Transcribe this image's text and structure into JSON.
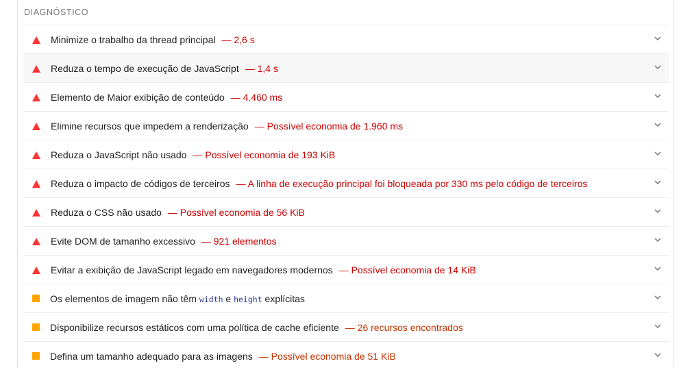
{
  "section": {
    "title": "DIAGNÓSTICO"
  },
  "audits": [
    {
      "status": "fail",
      "title": "Minimize o trabalho da thread principal",
      "display": "— 2,6 s"
    },
    {
      "status": "fail",
      "title": "Reduza o tempo de execução de JavaScript",
      "display": "— 1,4 s"
    },
    {
      "status": "fail",
      "title": "Elemento de Maior exibição de conteúdo",
      "display": "— 4.460 ms"
    },
    {
      "status": "fail",
      "title": "Elimine recursos que impedem a renderização",
      "display": "— Possível economia de 1.960 ms"
    },
    {
      "status": "fail",
      "title": "Reduza o JavaScript não usado",
      "display": "— Possível economia de 193 KiB"
    },
    {
      "status": "fail",
      "title": "Reduza o impacto de códigos de terceiros",
      "display": "— A linha de execução principal foi bloqueada por 330 ms pelo código de terceiros"
    },
    {
      "status": "fail",
      "title": "Reduza o CSS não usado",
      "display": "— Possível economia de 56 KiB"
    },
    {
      "status": "fail",
      "title": "Evite DOM de tamanho excessivo",
      "display": "— 921 elementos"
    },
    {
      "status": "fail",
      "title": "Evitar a exibição de JavaScript legado em navegadores modernos",
      "display": "— Possível economia de 14 KiB"
    },
    {
      "status": "average",
      "title_parts": {
        "before": "Os elementos de imagem não têm",
        "code1": "width",
        "middle": "e",
        "code2": "height",
        "after": "explícitas"
      },
      "display": ""
    },
    {
      "status": "average",
      "title": "Disponibilize recursos estáticos com uma política de cache eficiente",
      "display": "— 26 recursos encontrados"
    },
    {
      "status": "average",
      "title": "Defina um tamanho adequado para as imagens",
      "display": "— Possível economia de 51 KiB"
    }
  ],
  "colors": {
    "fail": "#ff3333",
    "fail_text": "#cc0000",
    "average": "#ffa400",
    "average_text": "#c33300"
  },
  "icons": {
    "fail": "red-triangle-icon",
    "average": "orange-square-icon",
    "expand": "chevron-down-icon"
  }
}
